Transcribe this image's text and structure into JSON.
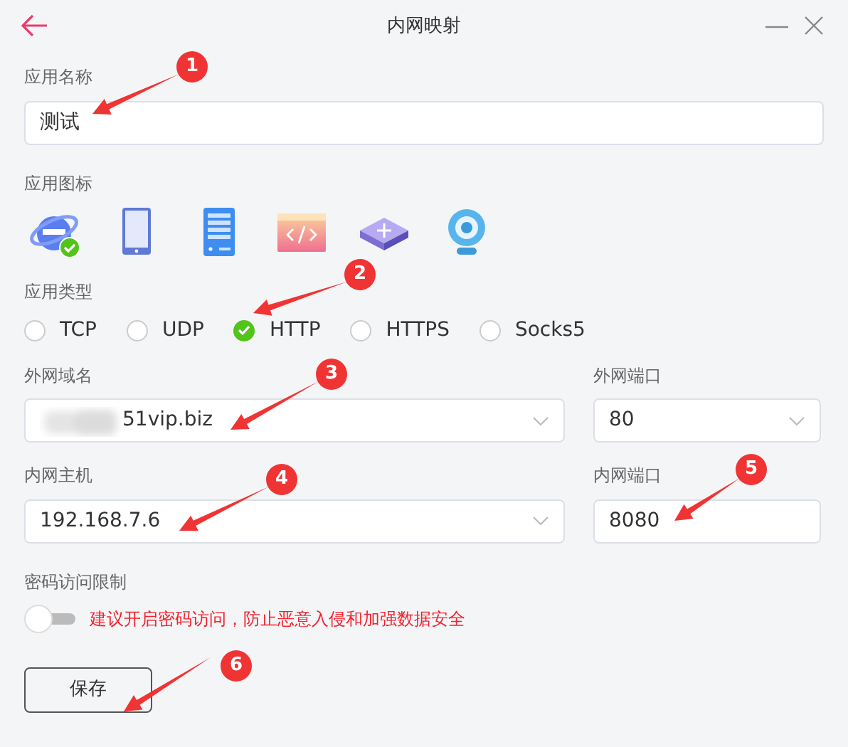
{
  "window": {
    "title": "内网映射"
  },
  "app_name": {
    "label": "应用名称",
    "value": "测试"
  },
  "app_icon": {
    "label": "应用图标",
    "icons": [
      {
        "kind": "browser",
        "selected": true
      },
      {
        "kind": "tablet",
        "selected": false
      },
      {
        "kind": "server",
        "selected": false
      },
      {
        "kind": "code",
        "selected": false
      },
      {
        "kind": "router",
        "selected": false
      },
      {
        "kind": "camera",
        "selected": false
      }
    ]
  },
  "app_type": {
    "label": "应用类型",
    "options": [
      {
        "label": "TCP",
        "selected": false
      },
      {
        "label": "UDP",
        "selected": false
      },
      {
        "label": "HTTP",
        "selected": true
      },
      {
        "label": "HTTPS",
        "selected": false
      },
      {
        "label": "Socks5",
        "selected": false
      }
    ]
  },
  "external_domain": {
    "label": "外网域名",
    "value": "51vip.biz",
    "redacted": true
  },
  "external_port": {
    "label": "外网端口",
    "value": "80"
  },
  "internal_host": {
    "label": "内网主机",
    "value": "192.168.7.6"
  },
  "internal_port": {
    "label": "内网端口",
    "value": "8080"
  },
  "password_limit": {
    "label": "密码访问限制",
    "on": false,
    "hint": "建议开启密码访问，防止恶意入侵和加强数据安全"
  },
  "save_button": "保存",
  "annotations": [
    {
      "number": "1"
    },
    {
      "number": "2"
    },
    {
      "number": "3"
    },
    {
      "number": "4"
    },
    {
      "number": "5"
    },
    {
      "number": "6"
    }
  ]
}
